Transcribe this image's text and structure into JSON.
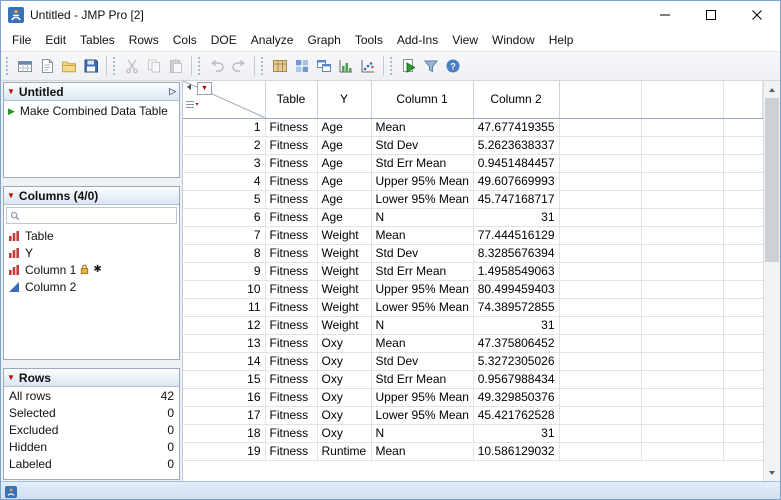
{
  "window": {
    "title": "Untitled - JMP Pro [2]"
  },
  "menu": {
    "items": [
      "File",
      "Edit",
      "Tables",
      "Rows",
      "Cols",
      "DOE",
      "Analyze",
      "Graph",
      "Tools",
      "Add-Ins",
      "View",
      "Window",
      "Help"
    ]
  },
  "toolbar": {
    "groups": [
      [
        "new-data-table",
        "new-journal",
        "open",
        "save"
      ],
      [
        "cut",
        "copy",
        "paste"
      ],
      [
        "undo",
        "redo"
      ],
      [
        "summary-table",
        "layout-grid",
        "tile-windows",
        "bar-chart",
        "scatter-plot"
      ],
      [
        "run-script",
        "data-filter",
        "help"
      ]
    ],
    "disabled": [
      "cut",
      "copy",
      "paste",
      "undo",
      "redo"
    ]
  },
  "sidebar": {
    "table_panel": {
      "title": "Untitled",
      "scripts": [
        "Make Combined Data Table"
      ]
    },
    "columns_panel": {
      "title": "Columns (4/0)",
      "search_placeholder": "",
      "items": [
        {
          "label": "Table",
          "type": "nominal",
          "badges": []
        },
        {
          "label": "Y",
          "type": "nominal",
          "badges": []
        },
        {
          "label": "Column 1",
          "type": "nominal",
          "badges": [
            "lock",
            "asterisk"
          ]
        },
        {
          "label": "Column 2",
          "type": "continuous",
          "badges": []
        }
      ]
    },
    "rows_panel": {
      "title": "Rows",
      "stats": [
        {
          "label": "All rows",
          "value": "42"
        },
        {
          "label": "Selected",
          "value": "0"
        },
        {
          "label": "Excluded",
          "value": "0"
        },
        {
          "label": "Hidden",
          "value": "0"
        },
        {
          "label": "Labeled",
          "value": "0"
        }
      ]
    }
  },
  "table": {
    "headers": [
      "Table",
      "Y",
      "Column 1",
      "Column 2"
    ],
    "rows": [
      [
        "1",
        "Fitness",
        "Age",
        "Mean",
        "47.677419355"
      ],
      [
        "2",
        "Fitness",
        "Age",
        "Std Dev",
        "5.2623638337"
      ],
      [
        "3",
        "Fitness",
        "Age",
        "Std Err Mean",
        "0.9451484457"
      ],
      [
        "4",
        "Fitness",
        "Age",
        "Upper 95% Mean",
        "49.607669993"
      ],
      [
        "5",
        "Fitness",
        "Age",
        "Lower 95% Mean",
        "45.747168717"
      ],
      [
        "6",
        "Fitness",
        "Age",
        "N",
        "31"
      ],
      [
        "7",
        "Fitness",
        "Weight",
        "Mean",
        "77.444516129"
      ],
      [
        "8",
        "Fitness",
        "Weight",
        "Std Dev",
        "8.3285676394"
      ],
      [
        "9",
        "Fitness",
        "Weight",
        "Std Err Mean",
        "1.4958549063"
      ],
      [
        "10",
        "Fitness",
        "Weight",
        "Upper 95% Mean",
        "80.499459403"
      ],
      [
        "11",
        "Fitness",
        "Weight",
        "Lower 95% Mean",
        "74.389572855"
      ],
      [
        "12",
        "Fitness",
        "Weight",
        "N",
        "31"
      ],
      [
        "13",
        "Fitness",
        "Oxy",
        "Mean",
        "47.375806452"
      ],
      [
        "14",
        "Fitness",
        "Oxy",
        "Std Dev",
        "5.3272305026"
      ],
      [
        "15",
        "Fitness",
        "Oxy",
        "Std Err Mean",
        "0.9567988434"
      ],
      [
        "16",
        "Fitness",
        "Oxy",
        "Upper 95% Mean",
        "49.329850376"
      ],
      [
        "17",
        "Fitness",
        "Oxy",
        "Lower 95% Mean",
        "45.421762528"
      ],
      [
        "18",
        "Fitness",
        "Oxy",
        "N",
        "31"
      ],
      [
        "19",
        "Fitness",
        "Runtime",
        "Mean",
        "10.586129032"
      ]
    ]
  }
}
